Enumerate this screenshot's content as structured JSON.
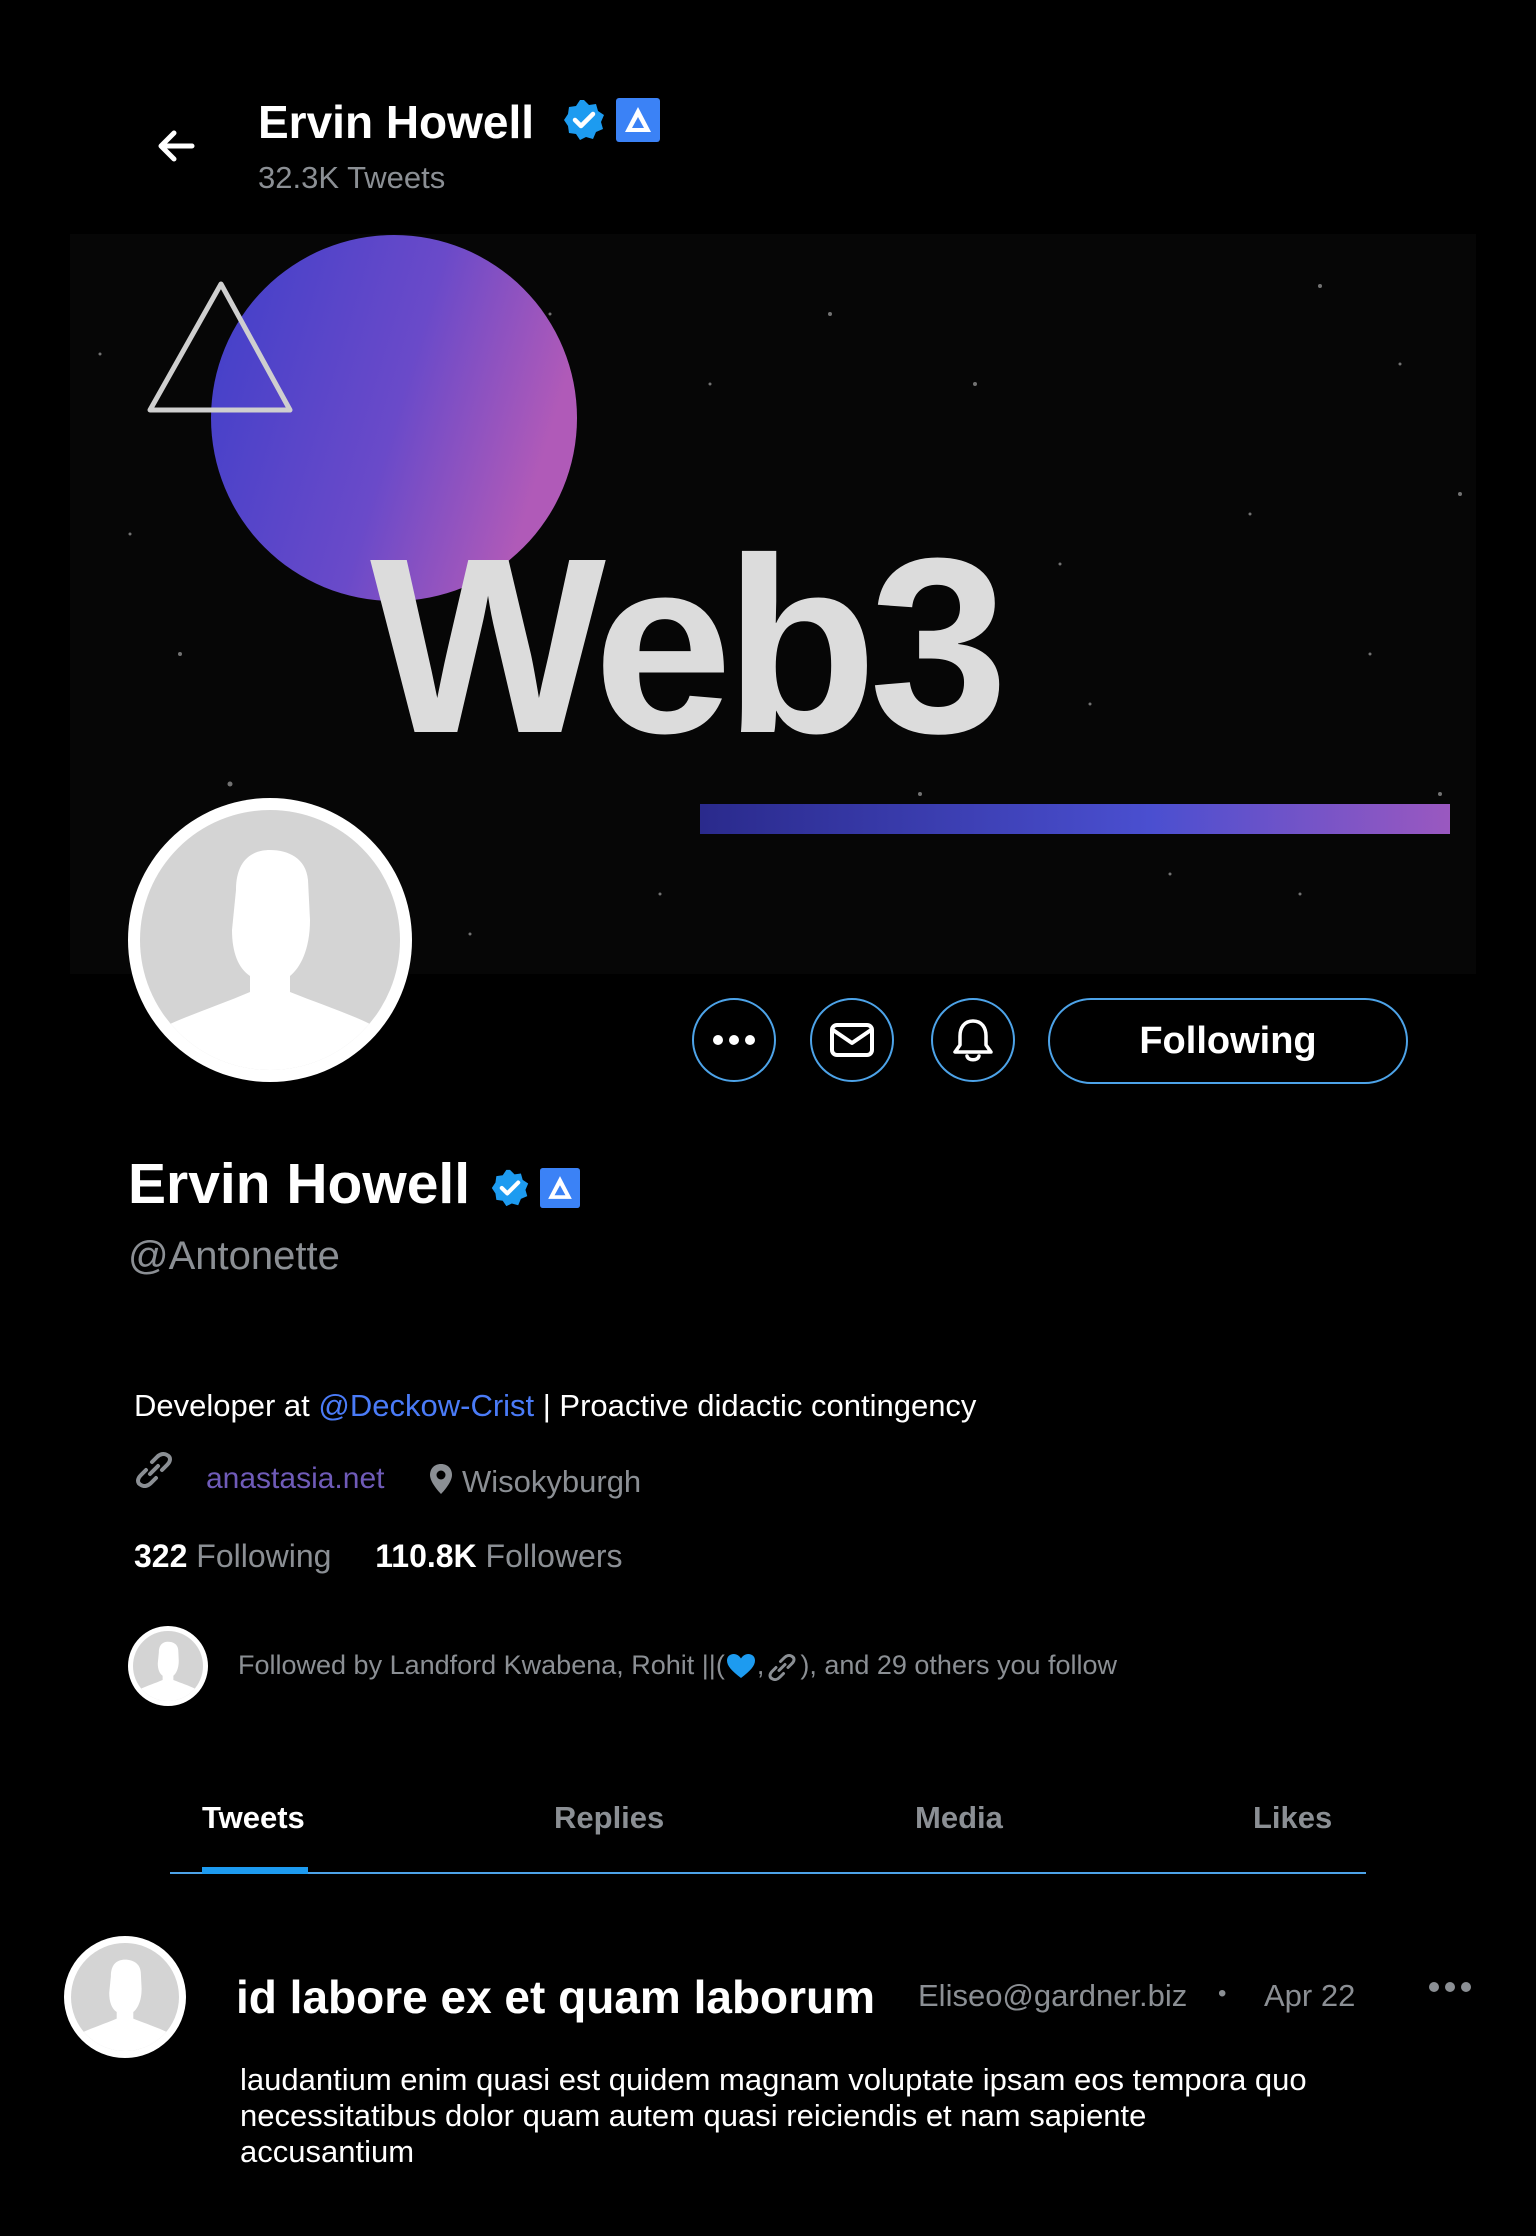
{
  "header": {
    "name": "Ervin Howell",
    "tweet_count": "32.3K Tweets"
  },
  "banner": {
    "text": "Web3"
  },
  "actions": {
    "follow_label": "Following"
  },
  "profile": {
    "name": "Ervin Howell",
    "handle": "@Antonette",
    "bio_prefix": "Developer at ",
    "bio_mention": "@Deckow-Crist",
    "bio_suffix": " | Proactive didactic contingency",
    "website": "anastasia.net",
    "location": "Wisokyburgh",
    "following_count": "322",
    "following_label": "Following",
    "followers_count": "110.8K",
    "followers_label": "Followers",
    "followed_by_prefix": "Followed by Landford Kwabena, Rohit ||(",
    "followed_by_suffix": "), and 29 others you follow"
  },
  "tabs": [
    {
      "label": "Tweets",
      "active": true
    },
    {
      "label": "Replies",
      "active": false
    },
    {
      "label": "Media",
      "active": false
    },
    {
      "label": "Likes",
      "active": false
    }
  ],
  "tweet": {
    "title": "id labore ex et quam laborum",
    "email": "Eliseo@gardner.biz",
    "separator": "•",
    "date": "Apr 22",
    "body": "laudantium enim quasi est quidem magnam voluptate ipsam eos tempora quo necessitatibus dolor quam autem quasi reiciendis et nam sapiente accusantium"
  },
  "colors": {
    "accent": "#1d9bf0",
    "button_border": "#4da3e8",
    "mention": "#4a7bf7",
    "website": "#6f5bb8",
    "muted": "#8b8f94",
    "verified": "#1d9bf0",
    "badge_blue": "#3b82f6"
  },
  "icons": {
    "back": "arrow-left-icon",
    "verified": "verified-badge-icon",
    "affiliate": "affiliate-badge-icon",
    "more": "more-dots-icon",
    "message": "envelope-icon",
    "notify": "bell-icon",
    "link": "link-icon",
    "location": "location-pin-icon"
  }
}
